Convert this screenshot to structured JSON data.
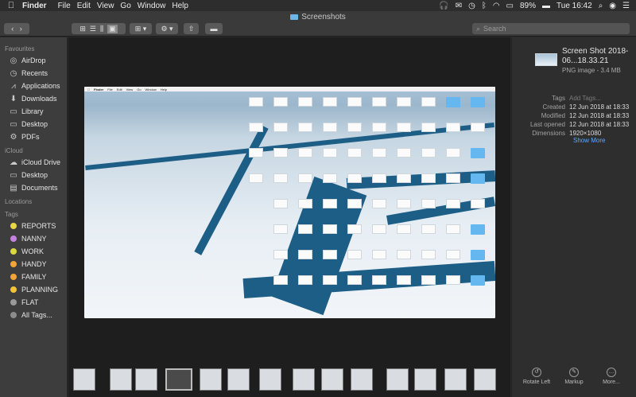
{
  "menubar": {
    "app": "Finder",
    "items": [
      "File",
      "Edit",
      "View",
      "Go",
      "Window",
      "Help"
    ],
    "battery": "89%",
    "clock": "Tue 16:42"
  },
  "window": {
    "title": "Screenshots"
  },
  "search": {
    "placeholder": "Search"
  },
  "sidebar": {
    "favourites_header": "Favourites",
    "favourites": [
      {
        "label": "AirDrop",
        "icon": "airdrop-icon",
        "glyph": "◎"
      },
      {
        "label": "Recents",
        "icon": "clock-icon",
        "glyph": "◷"
      },
      {
        "label": "Applications",
        "icon": "applications-icon",
        "glyph": "⩘"
      },
      {
        "label": "Downloads",
        "icon": "download-icon",
        "glyph": "⬇"
      },
      {
        "label": "Library",
        "icon": "folder-icon",
        "glyph": "▭"
      },
      {
        "label": "Desktop",
        "icon": "folder-icon",
        "glyph": "▭"
      },
      {
        "label": "PDFs",
        "icon": "gear-icon",
        "glyph": "⚙"
      }
    ],
    "icloud_header": "iCloud",
    "icloud": [
      {
        "label": "iCloud Drive",
        "icon": "cloud-icon",
        "glyph": "☁"
      },
      {
        "label": "Desktop",
        "icon": "folder-icon",
        "glyph": "▭"
      },
      {
        "label": "Documents",
        "icon": "document-icon",
        "glyph": "▤"
      }
    ],
    "locations_header": "Locations",
    "tags_header": "Tags",
    "tags": [
      {
        "label": "REPORTS",
        "color": "#e9d44a"
      },
      {
        "label": "NANNY",
        "color": "#c680e0"
      },
      {
        "label": "WORK",
        "color": "#dbd83f"
      },
      {
        "label": "HANDY",
        "color": "#f2a33a"
      },
      {
        "label": "FAMILY",
        "color": "#f2a33a"
      },
      {
        "label": "PLANNING",
        "color": "#f2c23a"
      },
      {
        "label": "FLAT",
        "color": "#9a9a9a"
      }
    ],
    "all_tags": "All Tags..."
  },
  "inspector": {
    "filename": "Screen Shot 2018-06...18.33.21",
    "kind": "PNG image - 3.4 MB",
    "tags_label": "Tags",
    "tags_placeholder": "Add Tags...",
    "created_label": "Created",
    "created": "12 Jun 2018 at 18:33",
    "modified_label": "Modified",
    "modified": "12 Jun 2018 at 18:33",
    "last_opened_label": "Last opened",
    "last_opened": "12 Jun 2018 at 18:33",
    "dimensions_label": "Dimensions",
    "dimensions": "1920×1080",
    "show_more": "Show More"
  },
  "actions": {
    "rotate_left": "Rotate Left",
    "markup": "Markup",
    "more": "More..."
  },
  "preview_menubar": [
    "Finder",
    "File",
    "Edit",
    "View",
    "Go",
    "Window",
    "Help"
  ],
  "colors": {
    "accent": "#5aa9ff",
    "folder": "#6bb6e8",
    "sea": "#1d5e86"
  }
}
